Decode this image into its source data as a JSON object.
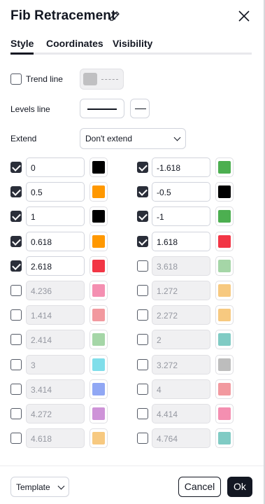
{
  "title": "Fib Retracement",
  "tabs": [
    {
      "label": "Style",
      "active": true
    },
    {
      "label": "Coordinates",
      "active": false
    },
    {
      "label": "Visibility",
      "active": false
    }
  ],
  "trend_line": {
    "label": "Trend line",
    "checked": false,
    "color": "#c0c0c2"
  },
  "levels_line": {
    "label": "Levels line"
  },
  "extend": {
    "label": "Extend",
    "value": "Don't extend"
  },
  "levels_left": [
    {
      "value": "0",
      "checked": true,
      "color": "#000000"
    },
    {
      "value": "0.5",
      "checked": true,
      "color": "#FF9800"
    },
    {
      "value": "1",
      "checked": true,
      "color": "#000000"
    },
    {
      "value": "0.618",
      "checked": true,
      "color": "#FF9800"
    },
    {
      "value": "2.618",
      "checked": true,
      "color": "#F23645"
    },
    {
      "value": "4.236",
      "checked": false,
      "color": "#F48FB1"
    },
    {
      "value": "1.414",
      "checked": false,
      "color": "#F2999F"
    },
    {
      "value": "2.414",
      "checked": false,
      "color": "#A5D6A7"
    },
    {
      "value": "3",
      "checked": false,
      "color": "#80DEEA"
    },
    {
      "value": "3.414",
      "checked": false,
      "color": "#90A7F4"
    },
    {
      "value": "4.272",
      "checked": false,
      "color": "#CE93D8"
    },
    {
      "value": "4.618",
      "checked": false,
      "color": "#F7C980"
    }
  ],
  "levels_right": [
    {
      "value": "-1.618",
      "checked": true,
      "color": "#4CAF50"
    },
    {
      "value": "-0.5",
      "checked": true,
      "color": "#000000"
    },
    {
      "value": "-1",
      "checked": true,
      "color": "#4CAF50"
    },
    {
      "value": "1.618",
      "checked": true,
      "color": "#F23645"
    },
    {
      "value": "3.618",
      "checked": false,
      "color": "#A5D6A7"
    },
    {
      "value": "1.272",
      "checked": false,
      "color": "#F7C980"
    },
    {
      "value": "2.272",
      "checked": false,
      "color": "#F7C980"
    },
    {
      "value": "2",
      "checked": false,
      "color": "#80CBC4"
    },
    {
      "value": "3.272",
      "checked": false,
      "color": "#BDBDBD"
    },
    {
      "value": "4",
      "checked": false,
      "color": "#F2999F"
    },
    {
      "value": "4.414",
      "checked": false,
      "color": "#F48FB1"
    },
    {
      "value": "4.764",
      "checked": false,
      "color": "#80CBC4"
    }
  ],
  "footer": {
    "template_label": "Template",
    "cancel_label": "Cancel",
    "ok_label": "Ok"
  }
}
